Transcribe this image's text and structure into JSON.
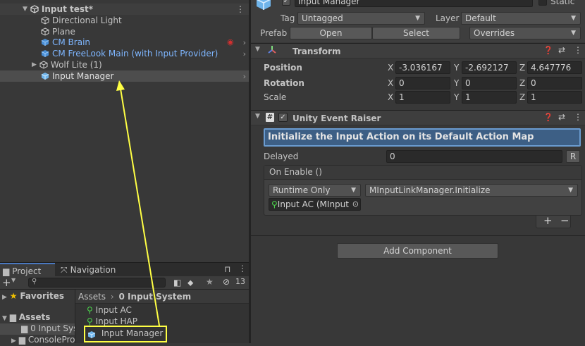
{
  "hierarchy": {
    "scene_name": "Input test*",
    "items": [
      {
        "label": "Directional Light"
      },
      {
        "label": "Plane"
      },
      {
        "label": "CM Brain"
      },
      {
        "label": "CM FreeLook Main (with Input Provider)"
      },
      {
        "label": "Wolf Lite (1)"
      },
      {
        "label": "Input Manager"
      }
    ]
  },
  "project": {
    "tab_project": "Project",
    "tab_navigation": "Navigation",
    "hidden_count": "13",
    "favorites_label": "Favorites",
    "assets_label": "Assets",
    "tree_items": [
      "0 Input Sys",
      "ConsolePro"
    ],
    "breadcrumb_root": "Assets",
    "breadcrumb_current": "0 Input System",
    "files": [
      {
        "label": "Input AC"
      },
      {
        "label": "Input HAP"
      },
      {
        "label": "Input Manager"
      }
    ]
  },
  "inspector": {
    "object_name": "Input Manager",
    "static_label": "Static",
    "tag_label": "Tag",
    "tag_value": "Untagged",
    "layer_label": "Layer",
    "layer_value": "Default",
    "prefab_label": "Prefab",
    "open_button": "Open",
    "select_button": "Select",
    "overrides_value": "Overrides",
    "transform": {
      "title": "Transform",
      "position_label": "Position",
      "rotation_label": "Rotation",
      "scale_label": "Scale",
      "axis_x": "X",
      "axis_y": "Y",
      "axis_z": "Z",
      "position": {
        "x": "-3.036167",
        "y": "-2.692127",
        "z": "4.647776"
      },
      "rotation": {
        "x": "0",
        "y": "0",
        "z": "0"
      },
      "scale": {
        "x": "1",
        "y": "1",
        "z": "1"
      }
    },
    "event_raiser": {
      "title": "Unity Event Raiser",
      "description": "Initialize the Input Action on its Default Action Map",
      "delayed_label": "Delayed",
      "delayed_value": "0",
      "reset_button": "R",
      "event_label": "On Enable ()",
      "runtime_value": "Runtime Only",
      "function_value": "MInputLinkManager.Initialize",
      "target_value": "Input AC (MInput",
      "add_button": "+",
      "remove_button": "−"
    },
    "add_component_button": "Add Component"
  },
  "colors": {
    "highlight_yellow": "#ffff44",
    "prefab_blue": "#7eb6ff",
    "selection_blue": "#3d5f85"
  }
}
